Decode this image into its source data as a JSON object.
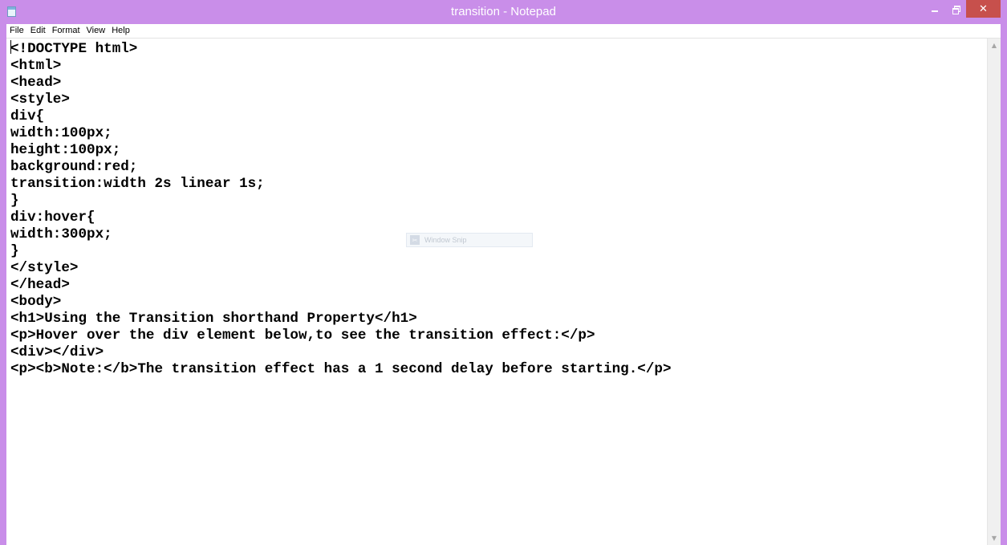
{
  "window": {
    "title": "transition - Notepad",
    "accent_color": "#c98ee9",
    "close_color": "#c7504c",
    "icon": "notepad-icon"
  },
  "controls": {
    "minimize": "minimize-icon",
    "restore": "restore-icon",
    "close_glyph": "✕"
  },
  "menu": {
    "items": [
      {
        "label": "File"
      },
      {
        "label": "Edit"
      },
      {
        "label": "Format"
      },
      {
        "label": "View"
      },
      {
        "label": "Help"
      }
    ]
  },
  "editor": {
    "lines": [
      "<!DOCTYPE html>",
      "<html>",
      "<head>",
      "<style>",
      "div{",
      "width:100px;",
      "height:100px;",
      "background:red;",
      "transition:width 2s linear 1s;",
      "}",
      "div:hover{",
      "width:300px;",
      "}",
      "</style>",
      "</head>",
      "<body>",
      "<h1>Using the Transition shorthand Property</h1>",
      "<p>Hover over the div element below,to see the transition effect:</p>",
      "<div></div>",
      "<p><b>Note:</b>The transition effect has a 1 second delay before starting.</p>"
    ]
  },
  "scrollbar": {
    "up_glyph": "▲",
    "down_glyph": "▼"
  },
  "overlay": {
    "ghost_text": "Window Snip"
  }
}
